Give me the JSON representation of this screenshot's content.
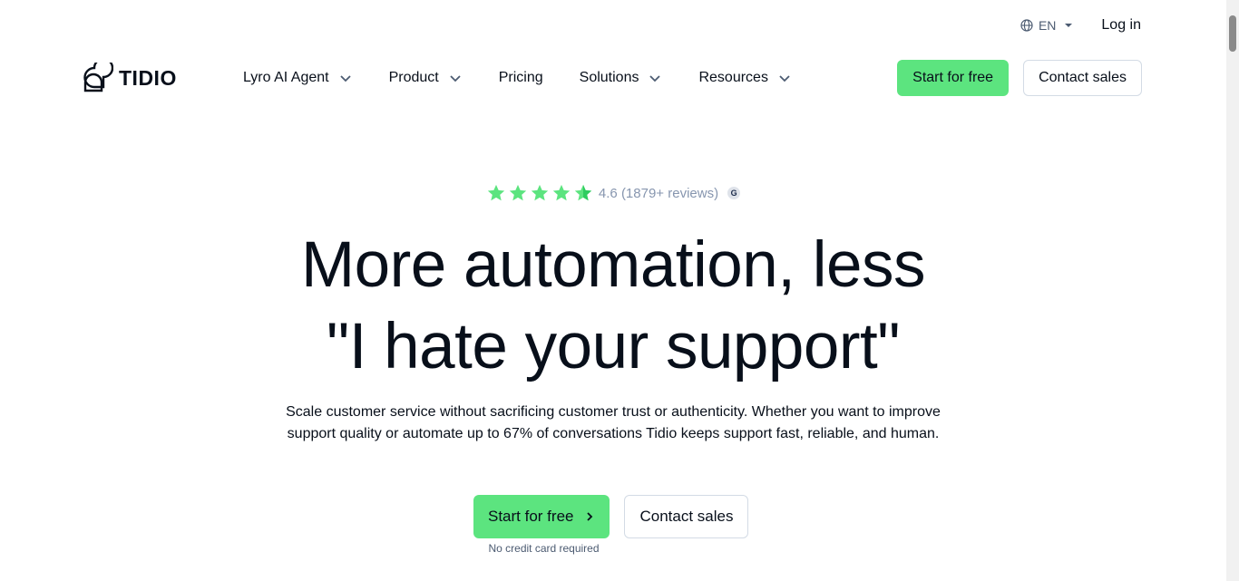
{
  "utility": {
    "language": "EN",
    "login": "Log in"
  },
  "nav": {
    "logo": "TIDIO",
    "menu": [
      {
        "label": "Lyro AI Agent",
        "has_dropdown": true
      },
      {
        "label": "Product",
        "has_dropdown": true
      },
      {
        "label": "Pricing",
        "has_dropdown": false
      },
      {
        "label": "Solutions",
        "has_dropdown": true
      },
      {
        "label": "Resources",
        "has_dropdown": true
      }
    ],
    "start_free": "Start for free",
    "contact_sales": "Contact sales"
  },
  "hero": {
    "rating": {
      "stars": 4.6,
      "text": "4.6 (1879+ reviews)",
      "source_icon": "G"
    },
    "headline_line1": "More automation, less",
    "headline_line2": "\"I hate your support\"",
    "sub_line1": "Scale customer service without sacrificing customer trust or authenticity. Whether you want to improve",
    "sub_line2": "support quality or automate up to 67% of conversations Tidio keeps support fast, reliable, and human.",
    "cta_primary": "Start for free",
    "cta_secondary": "Contact sales",
    "note": "No credit card required"
  },
  "colors": {
    "accent_green": "#5ce47f",
    "text_dark": "#080f1a",
    "muted": "#8796af",
    "border": "#d3dbe5"
  }
}
